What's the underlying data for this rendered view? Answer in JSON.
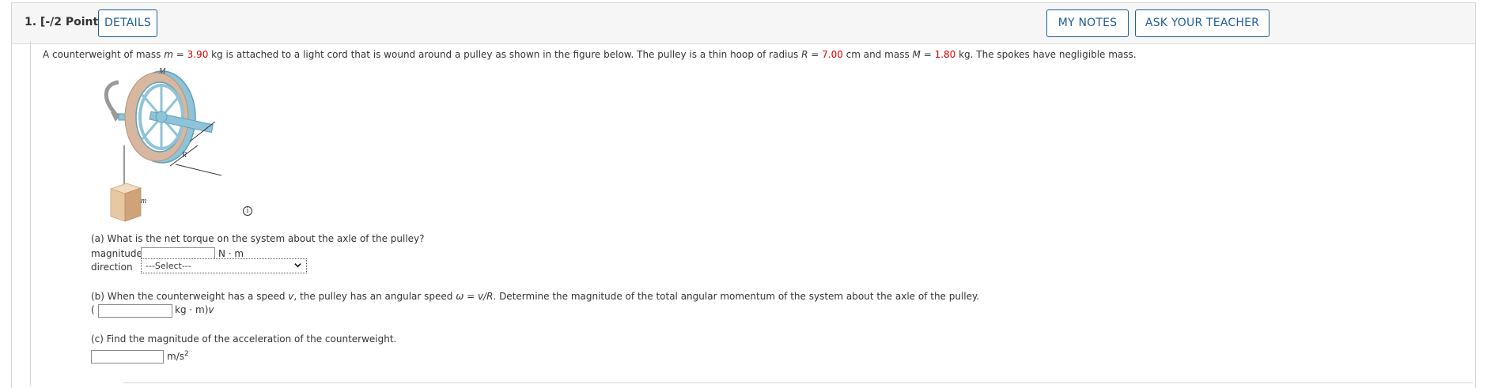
{
  "header": {
    "question_label": "1. [-/2 Points]",
    "details_button": "DETAILS",
    "my_notes_button": "MY NOTES",
    "ask_teacher_button": "ASK YOUR TEACHER"
  },
  "problem": {
    "t1": "A counterweight of mass ",
    "m_var": "m",
    "t2": " = ",
    "m_value": "3.90",
    "t3": " kg is attached to a light cord that is wound around a pulley as shown in the figure below. The pulley is a thin hoop of radius ",
    "R_var": "R",
    "t4": " = ",
    "R_value": "7.00",
    "t5": " cm and mass ",
    "M_var": "M",
    "t6": " = ",
    "M_value": "1.80",
    "t7": " kg. The spokes have negligible mass."
  },
  "figure": {
    "label_M": "M",
    "label_R": "R",
    "label_m": "m",
    "colors": {
      "hoop": "#8fc3d8",
      "hoop_dark": "#5f9fbc",
      "rope_wrap": "#d7b79f",
      "block": "#e8c8a3",
      "block_dark": "#cfa37a",
      "arrow": "#9a9a9a"
    }
  },
  "info_icon": "i",
  "part_a": {
    "question": "(a) What is the net torque on the system about the axle of the pulley?",
    "magnitude_label": "magnitude",
    "magnitude_value": "",
    "magnitude_unit": "N · m",
    "direction_label": "direction",
    "direction_selected": "---Select---"
  },
  "part_b": {
    "q1": "(b) When the counterweight has a speed ",
    "v_var": "v",
    "q2": ", the pulley has an angular speed ",
    "omega_var": "ω",
    "q3": " = ",
    "vr_var": "v/R",
    "q4": ". Determine the magnitude of the total angular momentum of the system about the axle of the pulley.",
    "open_paren": "(",
    "answer_value": "",
    "unit": "kg · m)",
    "unit_var": "v"
  },
  "part_c": {
    "question": "(c) Find the magnitude of the acceleration of the counterweight.",
    "answer_value": "",
    "unit": "m/s",
    "unit_sup": "2"
  }
}
